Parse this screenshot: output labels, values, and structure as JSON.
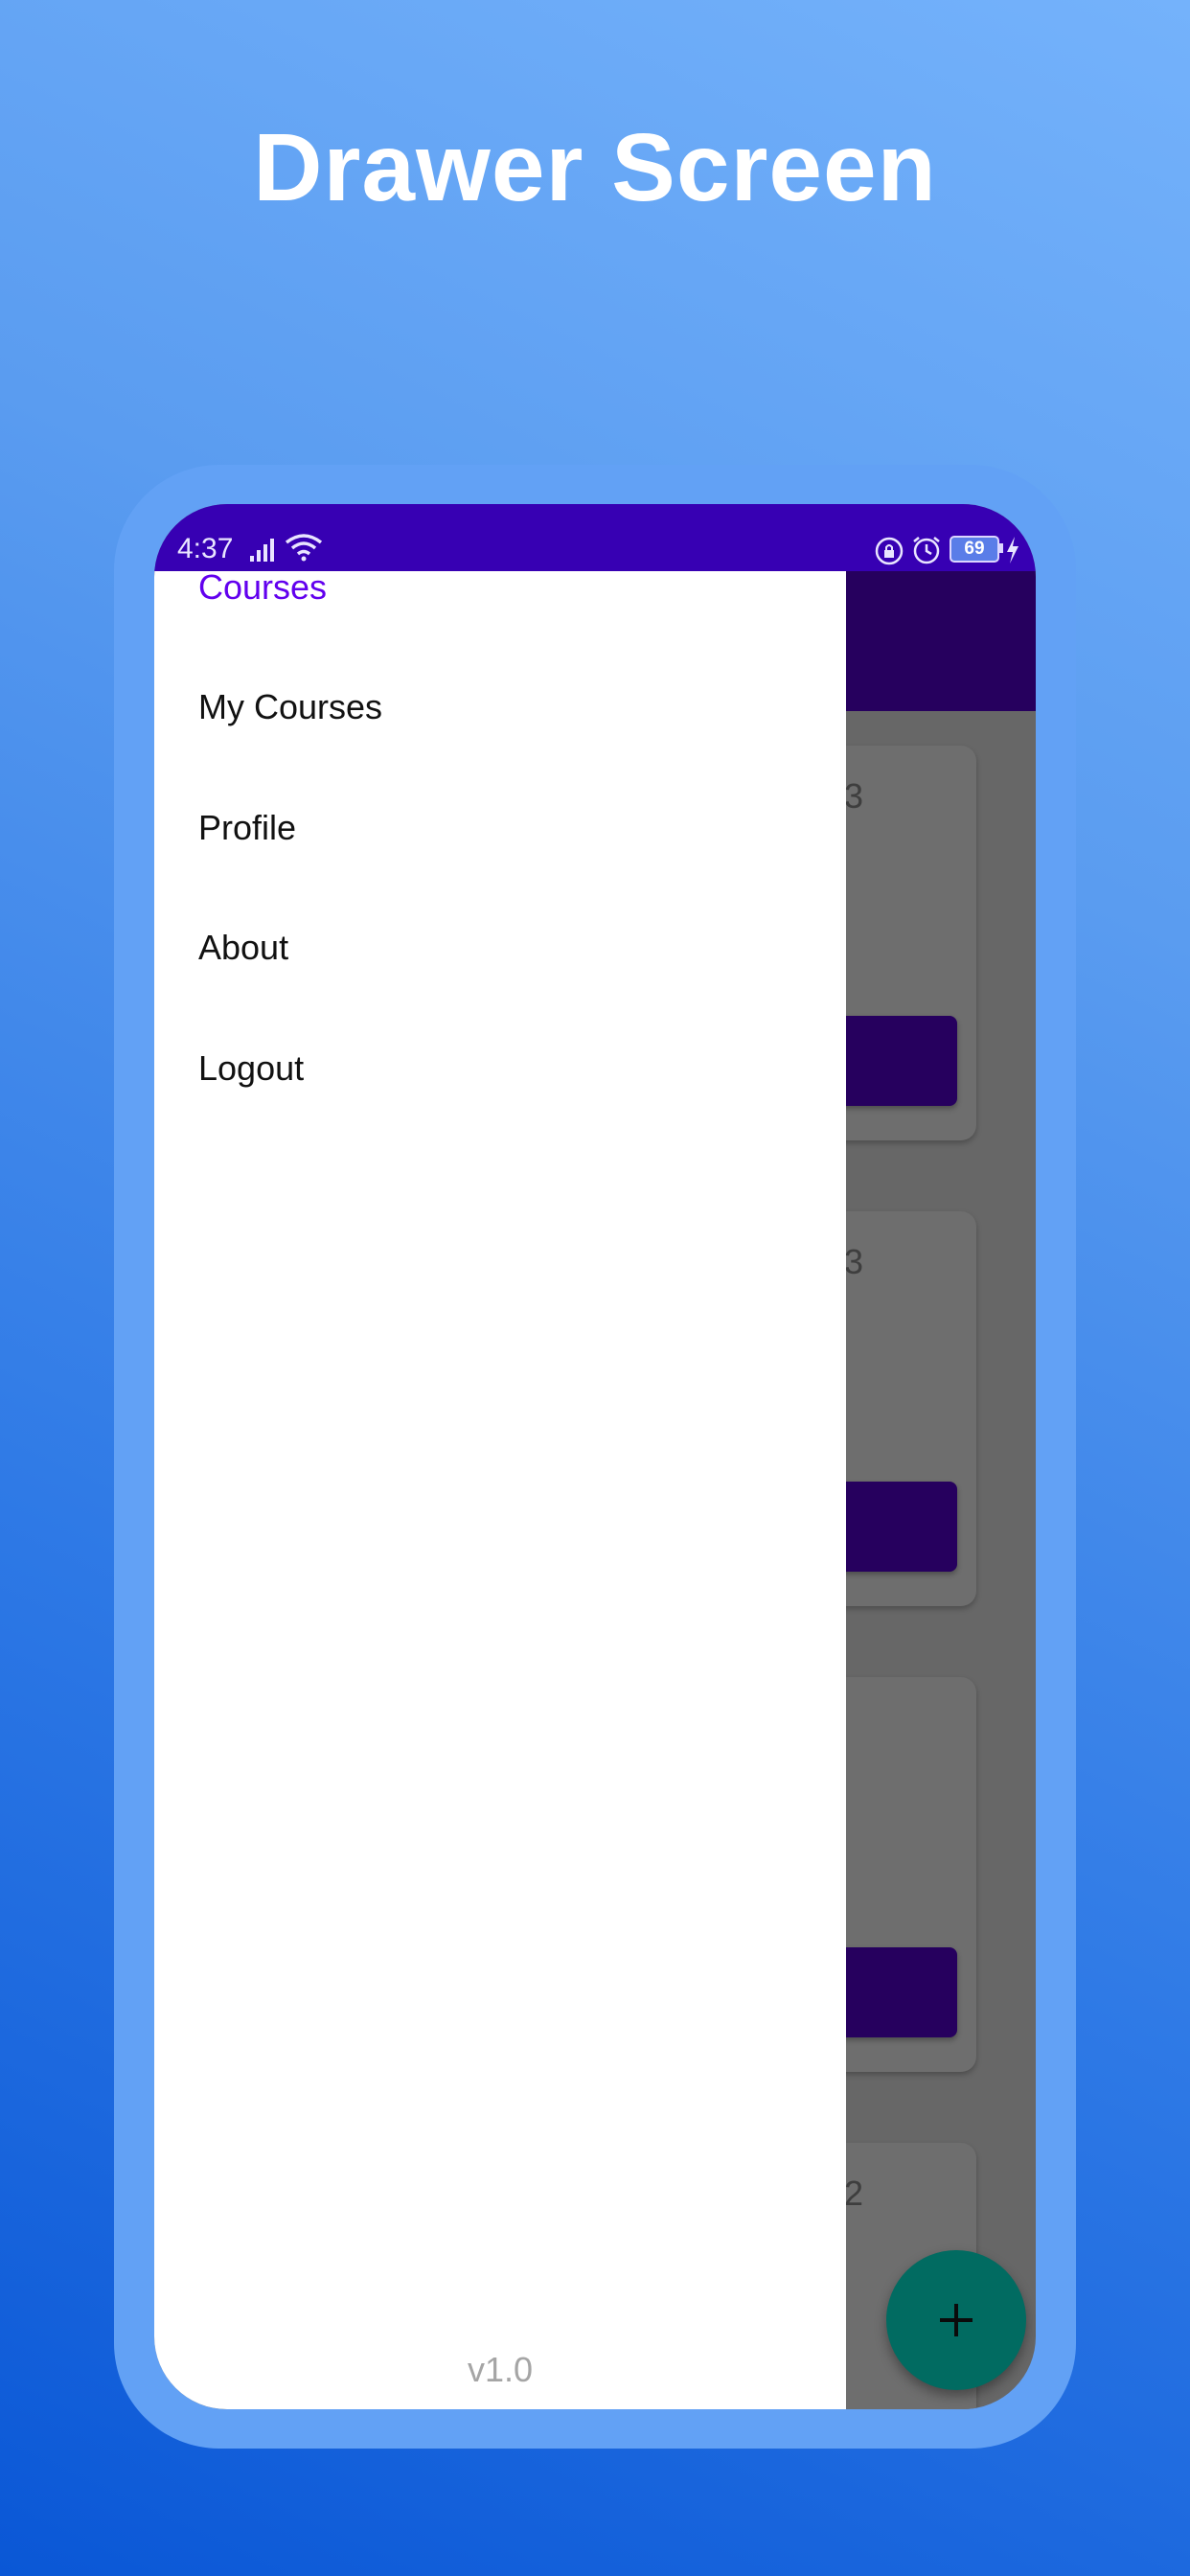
{
  "headline": "Drawer Screen",
  "status_bar": {
    "time": "4:37",
    "battery_level": "69"
  },
  "drawer": {
    "items": [
      {
        "label": "Courses",
        "active": true
      },
      {
        "label": "My Courses",
        "active": false
      },
      {
        "label": "Profile",
        "active": false
      },
      {
        "label": "About",
        "active": false
      },
      {
        "label": "Logout",
        "active": false
      }
    ],
    "version": "v1.0"
  },
  "course_cards": [
    {
      "partial_text": "3"
    },
    {
      "partial_text": "3"
    },
    {
      "partial_text": ""
    },
    {
      "partial_text": "2"
    }
  ],
  "fab": {
    "icon": "plus-icon"
  },
  "colors": {
    "status_bar": "#3700b3",
    "app_bar_dimmed": "#26005e",
    "drawer_active": "#6200ee",
    "fab": "#016b61",
    "background_top": "#74b2fb",
    "background_bottom": "#0a57d6"
  }
}
